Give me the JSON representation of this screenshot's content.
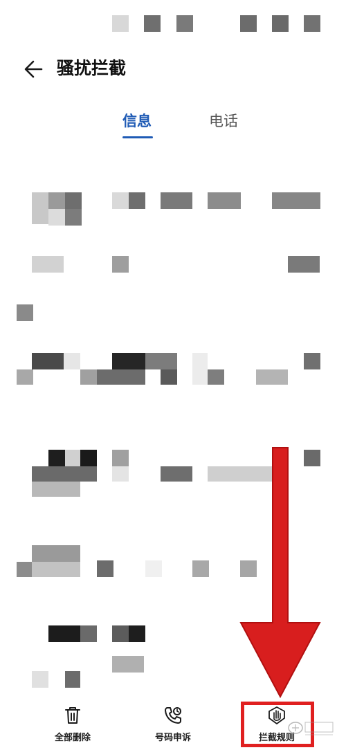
{
  "header": {
    "title": "骚扰拦截",
    "back_icon": "arrow-left-icon"
  },
  "tabs": [
    {
      "label": "信息",
      "active": true
    },
    {
      "label": "电话",
      "active": false
    }
  ],
  "bottom_bar": {
    "items": [
      {
        "label": "全部删除",
        "icon": "trash-icon"
      },
      {
        "label": "号码申诉",
        "icon": "phone-appeal-icon"
      },
      {
        "label": "拦截规则",
        "icon": "hand-shield-icon"
      }
    ]
  },
  "colors": {
    "accent": "#1f5bb5",
    "annotation": "#e02020"
  }
}
